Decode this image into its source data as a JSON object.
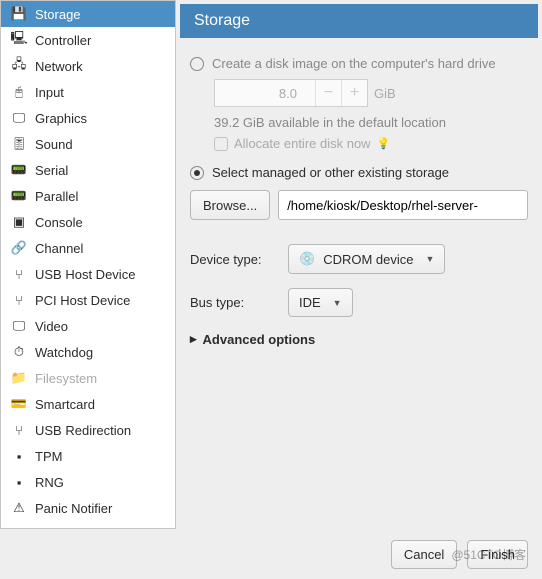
{
  "header": {
    "title": "Storage"
  },
  "sidebar": {
    "items": [
      {
        "label": "Storage",
        "icon": "💾"
      },
      {
        "label": "Controller",
        "icon": "🖳"
      },
      {
        "label": "Network",
        "icon": "🖧"
      },
      {
        "label": "Input",
        "icon": "🖰"
      },
      {
        "label": "Graphics",
        "icon": "🖵"
      },
      {
        "label": "Sound",
        "icon": "🎚"
      },
      {
        "label": "Serial",
        "icon": "📟"
      },
      {
        "label": "Parallel",
        "icon": "📟"
      },
      {
        "label": "Console",
        "icon": "▣"
      },
      {
        "label": "Channel",
        "icon": "🔗"
      },
      {
        "label": "USB Host Device",
        "icon": "⑂"
      },
      {
        "label": "PCI Host Device",
        "icon": "⑂"
      },
      {
        "label": "Video",
        "icon": "🖵"
      },
      {
        "label": "Watchdog",
        "icon": "⏱"
      },
      {
        "label": "Filesystem",
        "icon": "📁"
      },
      {
        "label": "Smartcard",
        "icon": "💳"
      },
      {
        "label": "USB Redirection",
        "icon": "⑂"
      },
      {
        "label": "TPM",
        "icon": "▪"
      },
      {
        "label": "RNG",
        "icon": "▪"
      },
      {
        "label": "Panic Notifier",
        "icon": "⚠"
      }
    ]
  },
  "storage": {
    "create_label": "Create a disk image on the computer's hard drive",
    "size_value": "8.0",
    "size_unit": "GiB",
    "available": "39.2 GiB available in the default location",
    "allocate_label": "Allocate entire disk now",
    "select_label": "Select managed or other existing storage",
    "browse_label": "Browse...",
    "path_value": "/home/kiosk/Desktop/rhel-server-"
  },
  "device": {
    "type_label": "Device type:",
    "type_value": "CDROM device",
    "bus_label": "Bus type:",
    "bus_value": "IDE"
  },
  "advanced": {
    "label": "Advanced options"
  },
  "footer": {
    "cancel": "Cancel",
    "finish": "Finish"
  },
  "watermark": "@51CTO博客"
}
